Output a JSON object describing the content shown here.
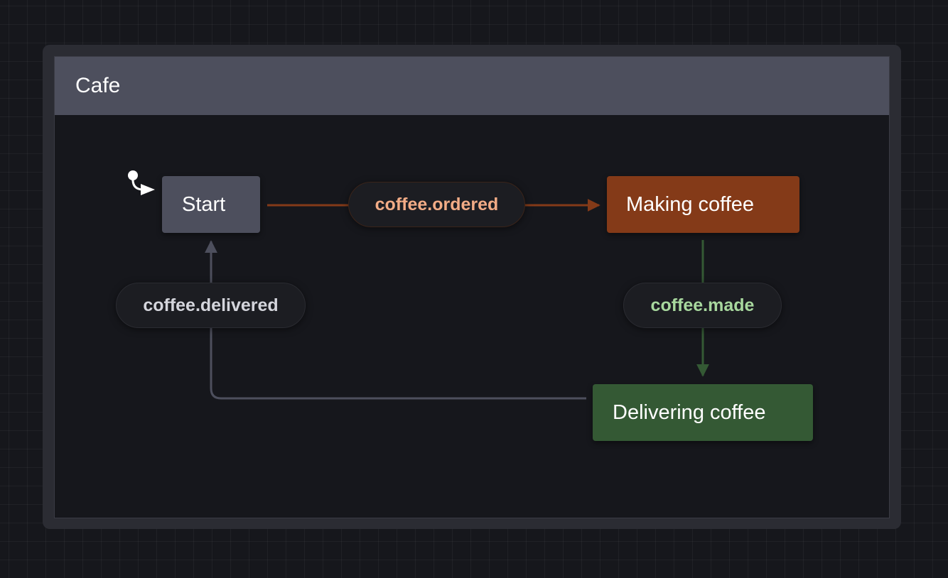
{
  "machine": {
    "title": "Cafe"
  },
  "states": {
    "start": {
      "label": "Start",
      "color": "#4d4f5d",
      "initial": true
    },
    "making": {
      "label": "Making coffee",
      "color": "#843a18"
    },
    "delivering": {
      "label": "Delivering coffee",
      "color": "#345934"
    }
  },
  "transitions": {
    "ordered": {
      "event": "coffee.ordered",
      "from": "Start",
      "to": "Making coffee",
      "color": "#843a18"
    },
    "made": {
      "event": "coffee.made",
      "from": "Making coffee",
      "to": "Delivering coffee",
      "color": "#345934"
    },
    "delivered": {
      "event": "coffee.delivered",
      "from": "Delivering coffee",
      "to": "Start",
      "color": "#4d4f5d"
    }
  }
}
